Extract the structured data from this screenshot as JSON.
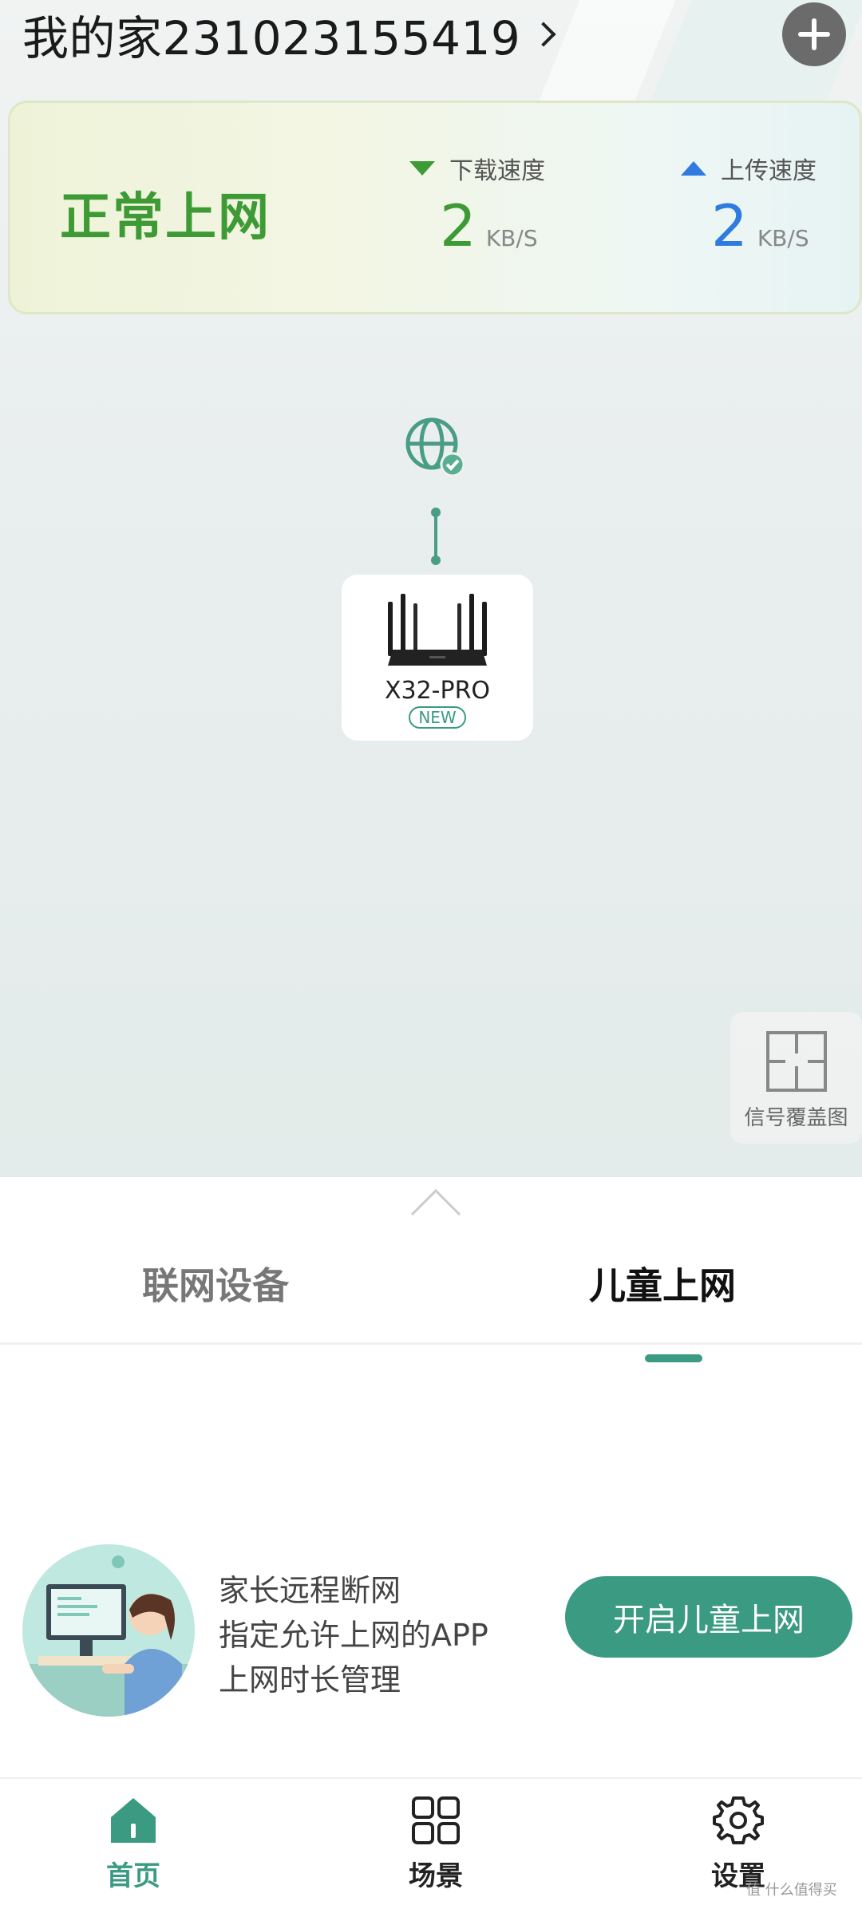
{
  "header": {
    "title": "我的家231023155419"
  },
  "status": {
    "text": "正常上网",
    "download": {
      "label": "下载速度",
      "value": "2",
      "unit": "KB/S"
    },
    "upload": {
      "label": "上传速度",
      "value": "2",
      "unit": "KB/S"
    }
  },
  "topology": {
    "router_name": "X32-PRO",
    "router_badge": "NEW"
  },
  "coverage": {
    "label": "信号覆盖图"
  },
  "tabs": [
    {
      "label": "联网设备",
      "active": false
    },
    {
      "label": "儿童上网",
      "active": true
    }
  ],
  "kids": {
    "features": [
      "家长远程断网",
      "指定允许上网的APP",
      "上网时长管理"
    ],
    "cta": "开启儿童上网"
  },
  "nav": [
    {
      "label": "首页",
      "icon": "home-icon",
      "active": true
    },
    {
      "label": "场景",
      "icon": "scenes-grid-icon",
      "active": false
    },
    {
      "label": "设置",
      "icon": "gear-icon",
      "active": false
    }
  ],
  "watermark": "值 什么值得买",
  "colors": {
    "accent": "#3a9a82",
    "download": "#3d9a35",
    "upload": "#2f7be0"
  }
}
